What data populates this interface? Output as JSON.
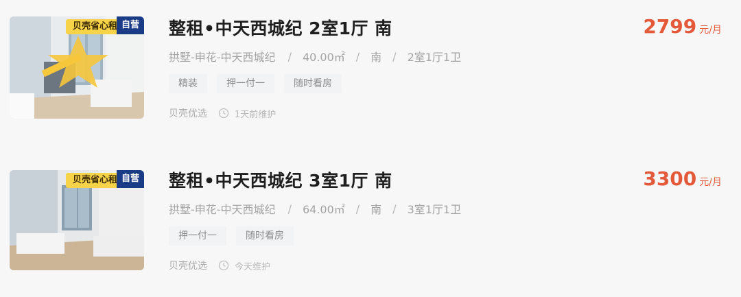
{
  "listings": [
    {
      "badge_brand": "贝壳省心租",
      "badge_self": "自营",
      "title": "整租•中天西城纪 2室1厅 南",
      "location": "拱墅-申花-中天西城纪",
      "area": "40.00㎡",
      "orientation": "南",
      "layout": "2室1厅1卫",
      "tags": [
        "精装",
        "押一付一",
        "随时看房"
      ],
      "source": "贝壳优选",
      "updated": "1天前维护",
      "price": "2799",
      "price_unit": "元/月"
    },
    {
      "badge_brand": "贝壳省心租",
      "badge_self": "自营",
      "title": "整租•中天西城纪 3室1厅 南",
      "location": "拱墅-申花-中天西城纪",
      "area": "64.00㎡",
      "orientation": "南",
      "layout": "3室1厅1卫",
      "tags": [
        "押一付一",
        "随时看房"
      ],
      "source": "贝壳优选",
      "updated": "今天维护",
      "price": "3300",
      "price_unit": "元/月"
    }
  ],
  "colors": {
    "price": "#e4593a",
    "brand_badge": "#f7d34a",
    "self_badge": "#1a3b86"
  }
}
